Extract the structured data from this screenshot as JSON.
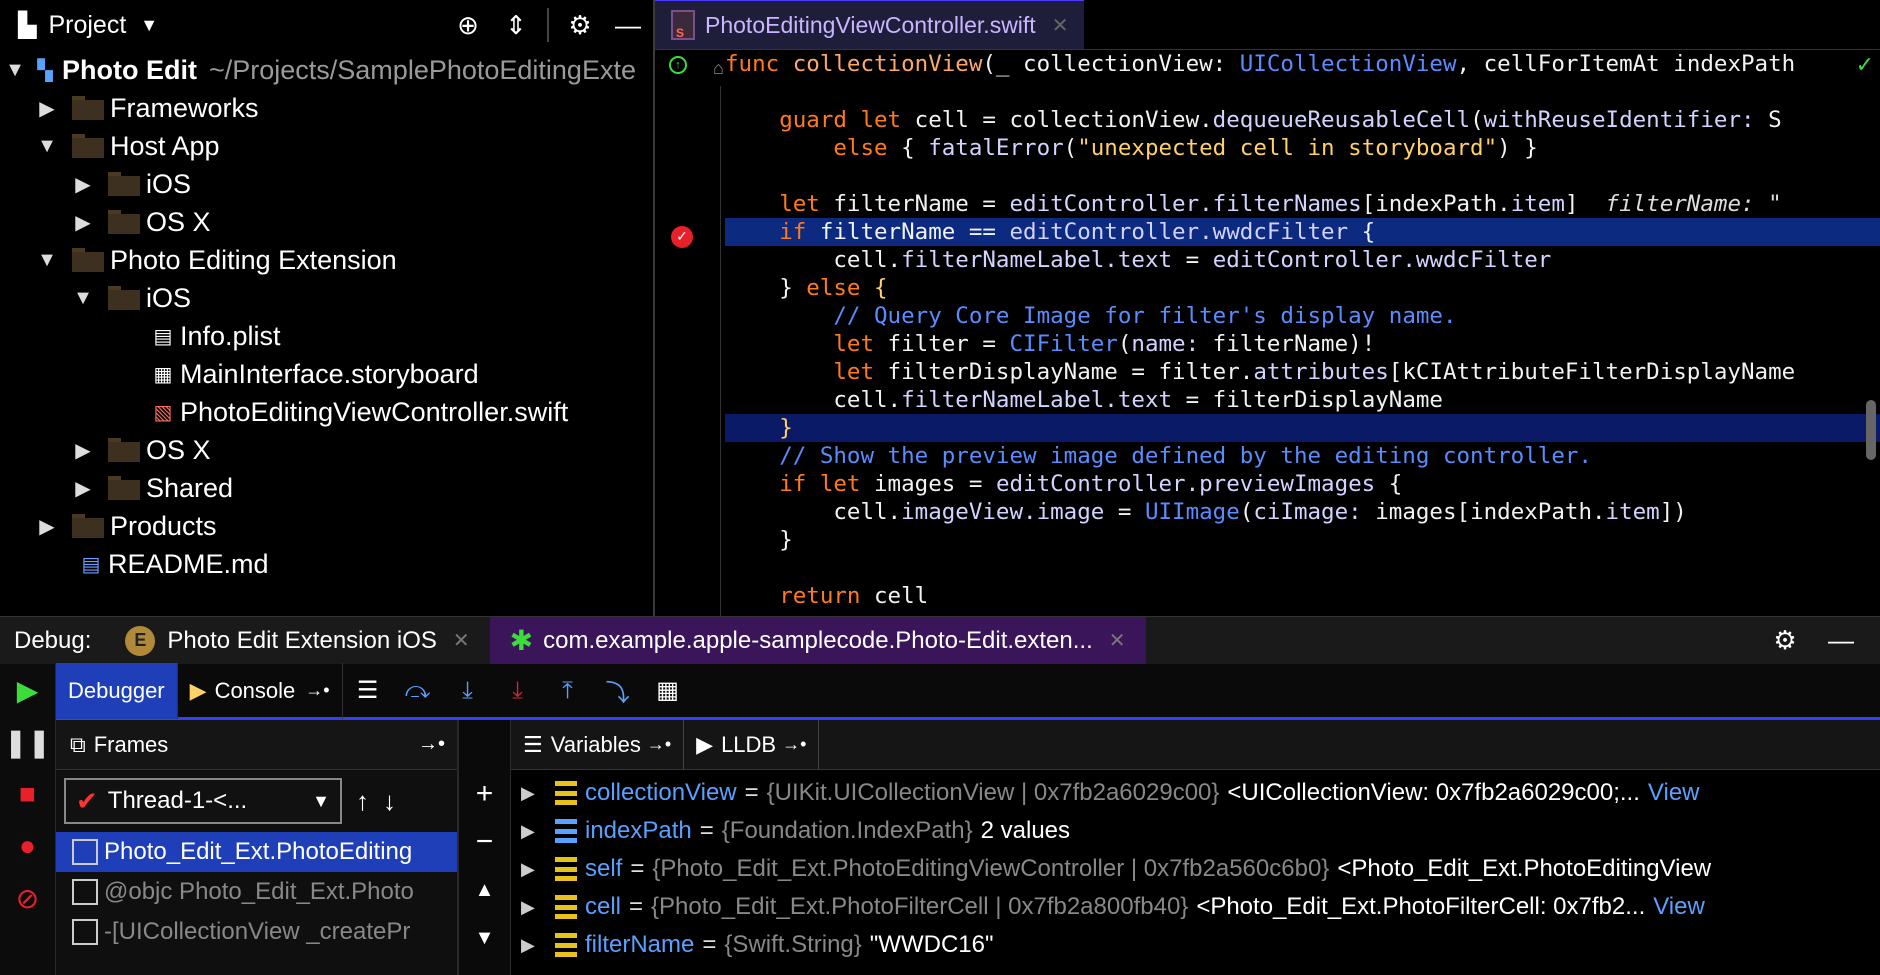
{
  "project": {
    "title": "Project",
    "root": {
      "name": "Photo Edit",
      "path": "~/Projects/SamplePhotoEditingExte"
    },
    "items": [
      {
        "label": "Frameworks"
      },
      {
        "label": "Host App"
      },
      {
        "label": "iOS"
      },
      {
        "label": "OS X"
      },
      {
        "label": "Photo Editing Extension"
      },
      {
        "label": "iOS"
      },
      {
        "label": "Info.plist"
      },
      {
        "label": "MainInterface.storyboard"
      },
      {
        "label": "PhotoEditingViewController.swift"
      },
      {
        "label": "OS X"
      },
      {
        "label": "Shared"
      },
      {
        "label": "Products"
      },
      {
        "label": "README.md"
      }
    ]
  },
  "editor": {
    "tab": "PhotoEditingViewController.swift",
    "hint": "filterName: \""
  },
  "debug": {
    "label": "Debug:",
    "tabs": [
      {
        "label": "Photo Edit Extension iOS"
      },
      {
        "label": "com.example.apple-samplecode.Photo-Edit.exten..."
      }
    ],
    "toolbar": {
      "debugger": "Debugger",
      "console": "Console"
    },
    "frames_header": "Frames",
    "thread": "Thread-1-<...",
    "frames": [
      "Photo_Edit_Ext.PhotoEditing",
      "@objc Photo_Edit_Ext.Photo",
      "-[UICollectionView _createPr"
    ],
    "variables_tab": "Variables",
    "lldb_tab": "LLDB",
    "variables": [
      {
        "name": "collectionView",
        "type": "{UIKit.UICollectionView | 0x7fb2a6029c00}",
        "value": "<UICollectionView: 0x7fb2a6029c00;...",
        "view": "View"
      },
      {
        "name": "indexPath",
        "type": "{Foundation.IndexPath}",
        "value": "2 values",
        "view": ""
      },
      {
        "name": "self",
        "type": "{Photo_Edit_Ext.PhotoEditingViewController | 0x7fb2a560c6b0}",
        "value": "<Photo_Edit_Ext.PhotoEditingView",
        "view": ""
      },
      {
        "name": "cell",
        "type": "{Photo_Edit_Ext.PhotoFilterCell | 0x7fb2a800fb40}",
        "value": "<Photo_Edit_Ext.PhotoFilterCell: 0x7fb2...",
        "view": "View"
      },
      {
        "name": "filterName",
        "type": "{Swift.String}",
        "value": "\"WWDC16\"",
        "view": ""
      }
    ]
  },
  "colors": {
    "keyword": "#ff7a1a",
    "type": "#5a8cff",
    "string": "#ffd166",
    "selection": "#1f3fb8",
    "debugTabActive": "#3a155a"
  }
}
